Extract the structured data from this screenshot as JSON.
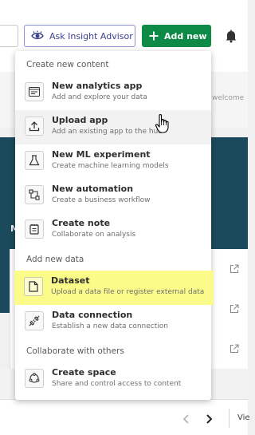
{
  "header": {
    "insight_button_label": "Ask Insight Advisor",
    "add_new_label": "Add new"
  },
  "background": {
    "welcome_fragment": "welcome",
    "hero_letter": "M",
    "pager_fragment": "Vie"
  },
  "menu": {
    "sections": [
      {
        "header": "Create new content"
      },
      {
        "header": "Add new data"
      },
      {
        "header": "Collaborate with others"
      }
    ],
    "items": [
      {
        "icon": "analytics-app-icon",
        "title": "New analytics app",
        "desc": "Add and explore your data"
      },
      {
        "icon": "upload-icon",
        "title": "Upload app",
        "desc": "Add an existing app to the hub"
      },
      {
        "icon": "flask-icon",
        "title": "New ML experiment",
        "desc": "Create machine learning models"
      },
      {
        "icon": "automation-icon",
        "title": "New automation",
        "desc": "Create a business workflow"
      },
      {
        "icon": "note-icon",
        "title": "Create note",
        "desc": "Collaborate on analysis"
      },
      {
        "icon": "dataset-file-icon",
        "title": "Dataset",
        "desc": "Upload a data file or register external data"
      },
      {
        "icon": "connection-plug-icon",
        "title": "Data connection",
        "desc": "Establish a new data connection"
      },
      {
        "icon": "space-icon",
        "title": "Create space",
        "desc": "Share and control access to content"
      }
    ]
  },
  "colors": {
    "accent_green": "#0c8a46",
    "insight_purple": "#3a3f8f",
    "highlight_yellow": "#fbfb8a",
    "hero_teal": "#1b4a5c"
  }
}
